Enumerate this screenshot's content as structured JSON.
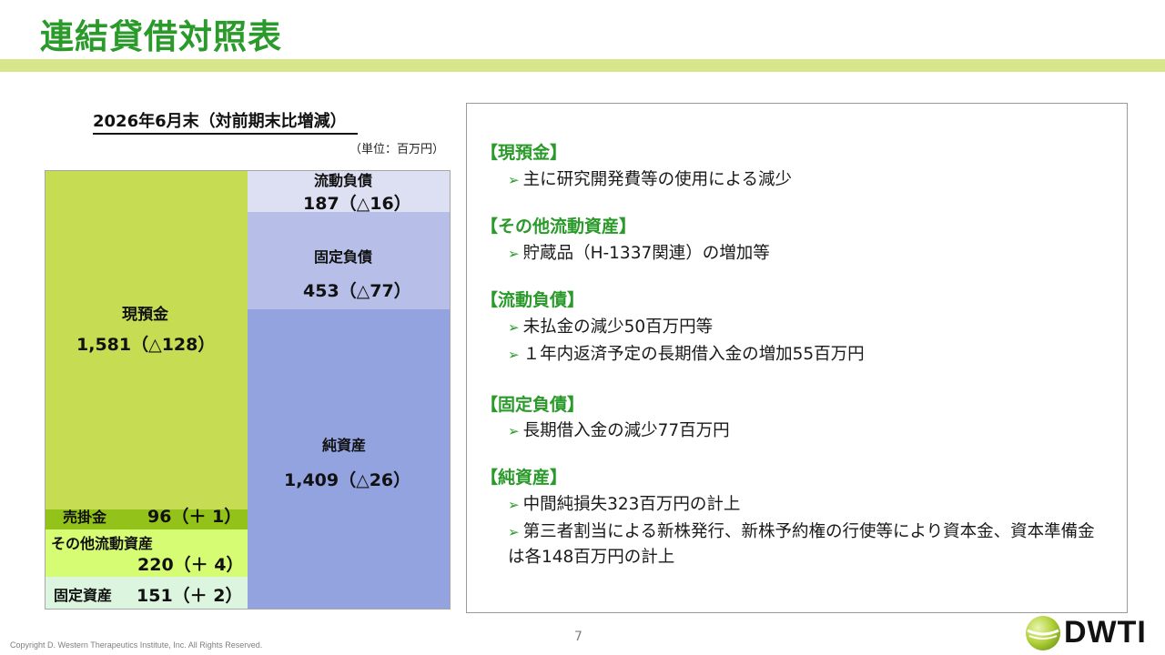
{
  "page": {
    "title": "連結貸借対照表",
    "page_number": "7"
  },
  "balance_sheet": {
    "subtitle": "2026年6月末（対前期末比増減）",
    "unit": "（単位：百万円）",
    "assets": {
      "cash": {
        "label": "現預金",
        "value": "1,581（△128）"
      },
      "ar": {
        "label": "売掛金",
        "value": "96（＋ 1）"
      },
      "other_current": {
        "label": "その他流動資産",
        "value": "220（＋ 4）"
      },
      "fixed": {
        "label": "固定資産",
        "value": "151（＋ 2）"
      }
    },
    "liabilities": {
      "current": {
        "label": "流動負債",
        "value": "187（△16）"
      },
      "fixed": {
        "label": "固定負債",
        "value": "453（△77）"
      },
      "net_assets": {
        "label": "純資産",
        "value": "1,409（△26）"
      }
    }
  },
  "notes": [
    {
      "heading": "【現預金】",
      "bullets": [
        "主に研究開発費等の使用による減少"
      ]
    },
    {
      "heading": "【その他流動資産】",
      "bullets": [
        "貯蔵品（H-1337関連）の増加等"
      ]
    },
    {
      "heading": "【流動負債】",
      "bullets": [
        "未払金の減少50百万円等",
        "１年内返済予定の長期借入金の増加55百万円"
      ]
    },
    {
      "heading": "【固定負債】",
      "bullets": [
        "長期借入金の減少77百万円"
      ]
    },
    {
      "heading": "【純資産】",
      "bullets": [
        "中間純損失323百万円の計上",
        "第三者割当による新株発行、新株予約権の行使等により資本金、資本準備金は各148百万円の計上"
      ]
    }
  ],
  "footer": {
    "copyright": "Copyright D. Western Therapeutics Institute, Inc. All Rights Reserved.",
    "logo_text": "DWTI"
  },
  "colors": {
    "title_green": "#2a9a2a",
    "title_bar": "#d7e68a",
    "cash": "#c6dc52",
    "ar": "#93c21b",
    "other_current": "#d6fc74",
    "fixed_assets": "#dcf5de",
    "current_liab": "#dde0f3",
    "fixed_liab": "#b7bfe9",
    "net_assets": "#93a3df"
  }
}
